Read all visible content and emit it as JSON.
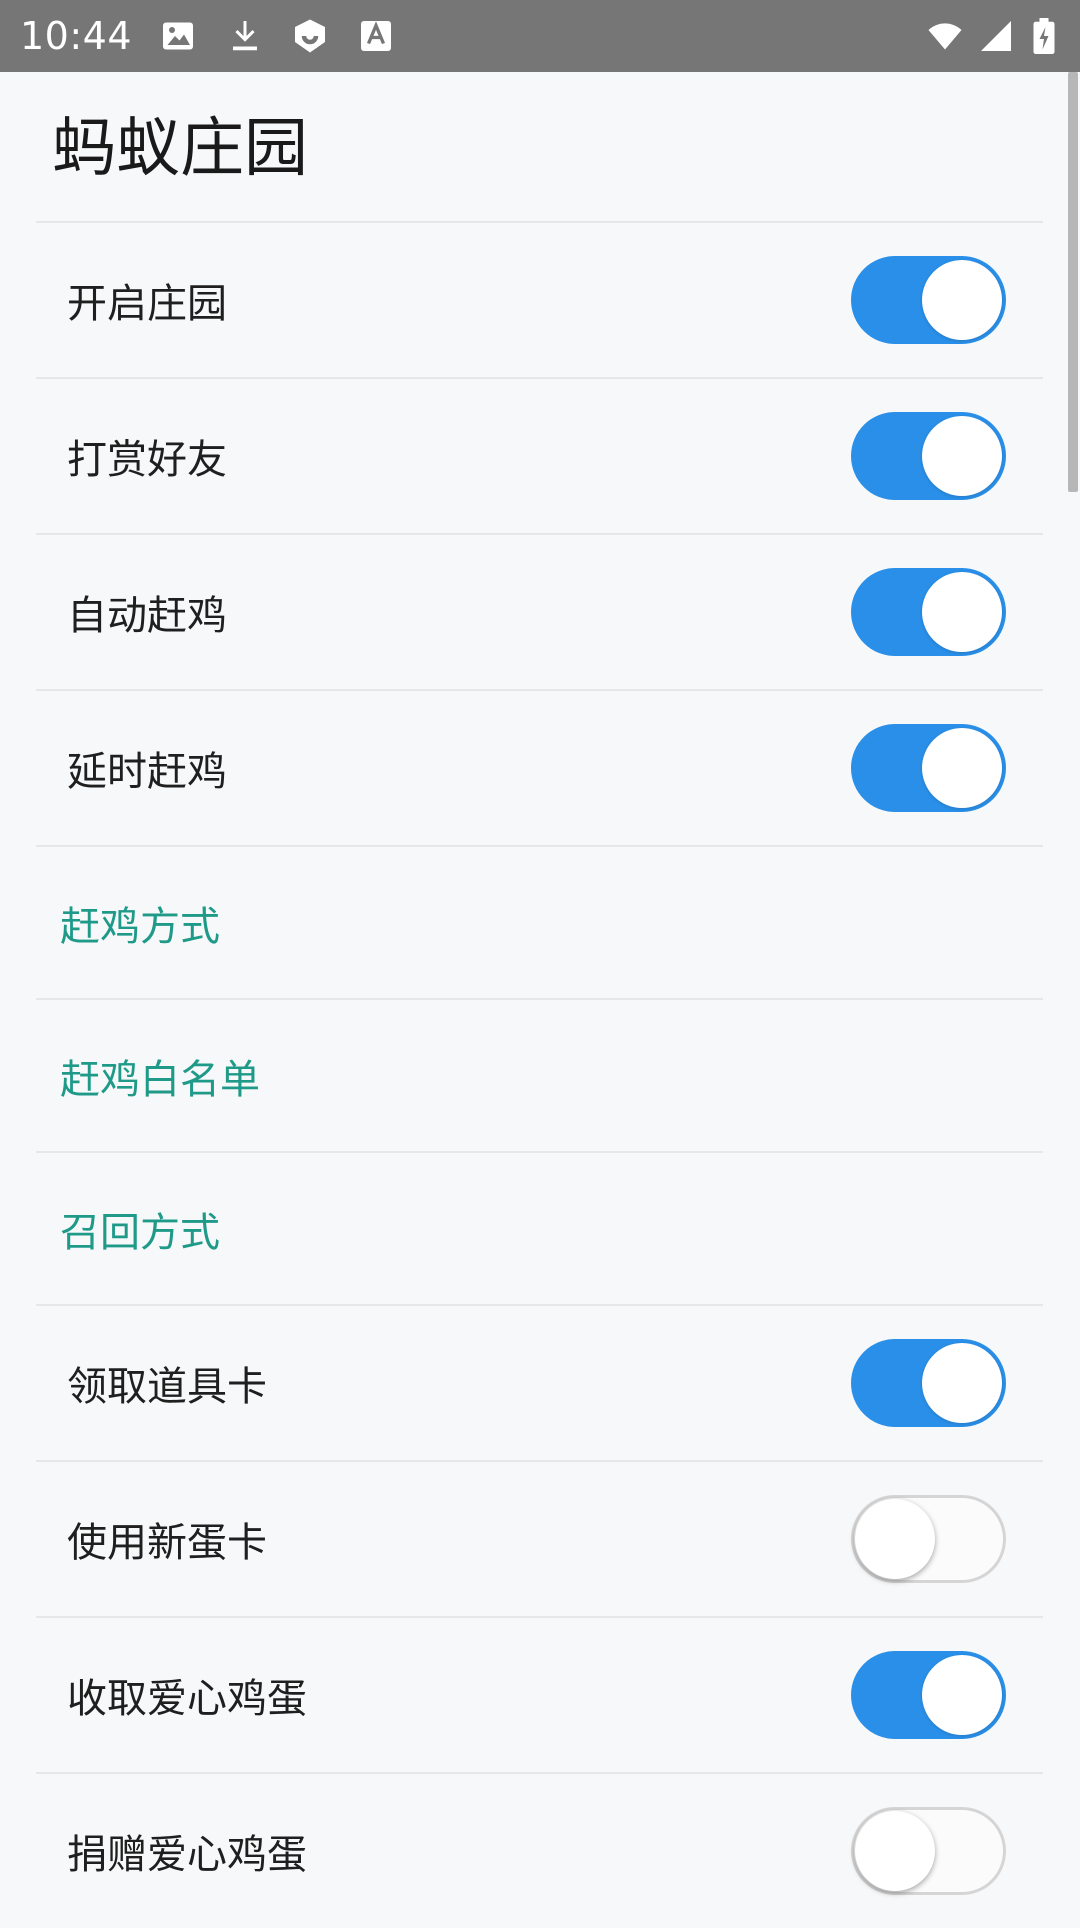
{
  "status_bar": {
    "time": "10:44",
    "left_icons": [
      "image-icon",
      "download-icon",
      "shield-icon",
      "keyboard-a-icon"
    ],
    "right_icons": [
      "wifi-icon",
      "signal-icon",
      "battery-icon"
    ]
  },
  "page": {
    "title": "蚂蚁庄园"
  },
  "items": [
    {
      "type": "switch",
      "label": "开启庄园",
      "checked": true
    },
    {
      "type": "switch",
      "label": "打赏好友",
      "checked": true
    },
    {
      "type": "switch",
      "label": "自动赶鸡",
      "checked": true
    },
    {
      "type": "switch",
      "label": "延时赶鸡",
      "checked": true
    },
    {
      "type": "link",
      "label": "赶鸡方式"
    },
    {
      "type": "link",
      "label": "赶鸡白名单"
    },
    {
      "type": "link",
      "label": "召回方式"
    },
    {
      "type": "switch",
      "label": "领取道具卡",
      "checked": true
    },
    {
      "type": "switch",
      "label": "使用新蛋卡",
      "checked": false
    },
    {
      "type": "switch",
      "label": "收取爱心鸡蛋",
      "checked": true
    },
    {
      "type": "switch",
      "label": "捐赠爱心鸡蛋",
      "checked": false
    }
  ],
  "colors": {
    "accent": "#2a8fe8",
    "link_text": "#1f9a89",
    "status_bar": "#767676",
    "background": "#f7f8f9"
  }
}
